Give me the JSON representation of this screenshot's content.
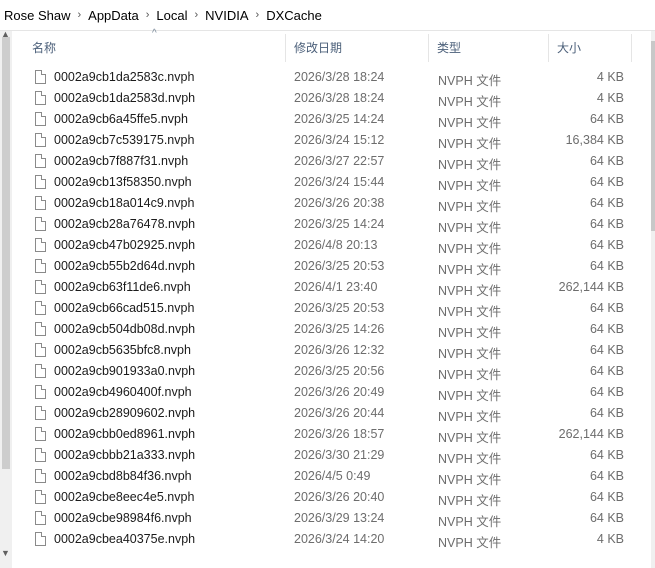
{
  "breadcrumb": [
    "Rose Shaw",
    "AppData",
    "Local",
    "NVIDIA",
    "DXCache"
  ],
  "columns": {
    "name": "名称",
    "date": "修改日期",
    "type": "类型",
    "size": "大小"
  },
  "files": [
    {
      "name": "0002a9cb1da2583c.nvph",
      "date": "2026/3/28 18:24",
      "type": "NVPH 文件",
      "size": "4 KB"
    },
    {
      "name": "0002a9cb1da2583d.nvph",
      "date": "2026/3/28 18:24",
      "type": "NVPH 文件",
      "size": "4 KB"
    },
    {
      "name": "0002a9cb6a45ffe5.nvph",
      "date": "2026/3/25 14:24",
      "type": "NVPH 文件",
      "size": "64 KB"
    },
    {
      "name": "0002a9cb7c539175.nvph",
      "date": "2026/3/24 15:12",
      "type": "NVPH 文件",
      "size": "16,384 KB"
    },
    {
      "name": "0002a9cb7f887f31.nvph",
      "date": "2026/3/27 22:57",
      "type": "NVPH 文件",
      "size": "64 KB"
    },
    {
      "name": "0002a9cb13f58350.nvph",
      "date": "2026/3/24 15:44",
      "type": "NVPH 文件",
      "size": "64 KB"
    },
    {
      "name": "0002a9cb18a014c9.nvph",
      "date": "2026/3/26 20:38",
      "type": "NVPH 文件",
      "size": "64 KB"
    },
    {
      "name": "0002a9cb28a76478.nvph",
      "date": "2026/3/25 14:24",
      "type": "NVPH 文件",
      "size": "64 KB"
    },
    {
      "name": "0002a9cb47b02925.nvph",
      "date": "2026/4/8 20:13",
      "type": "NVPH 文件",
      "size": "64 KB"
    },
    {
      "name": "0002a9cb55b2d64d.nvph",
      "date": "2026/3/25 20:53",
      "type": "NVPH 文件",
      "size": "64 KB"
    },
    {
      "name": "0002a9cb63f11de6.nvph",
      "date": "2026/4/1 23:40",
      "type": "NVPH 文件",
      "size": "262,144 KB"
    },
    {
      "name": "0002a9cb66cad515.nvph",
      "date": "2026/3/25 20:53",
      "type": "NVPH 文件",
      "size": "64 KB"
    },
    {
      "name": "0002a9cb504db08d.nvph",
      "date": "2026/3/25 14:26",
      "type": "NVPH 文件",
      "size": "64 KB"
    },
    {
      "name": "0002a9cb5635bfc8.nvph",
      "date": "2026/3/26 12:32",
      "type": "NVPH 文件",
      "size": "64 KB"
    },
    {
      "name": "0002a9cb901933a0.nvph",
      "date": "2026/3/25 20:56",
      "type": "NVPH 文件",
      "size": "64 KB"
    },
    {
      "name": "0002a9cb4960400f.nvph",
      "date": "2026/3/26 20:49",
      "type": "NVPH 文件",
      "size": "64 KB"
    },
    {
      "name": "0002a9cb28909602.nvph",
      "date": "2026/3/26 20:44",
      "type": "NVPH 文件",
      "size": "64 KB"
    },
    {
      "name": "0002a9cbb0ed8961.nvph",
      "date": "2026/3/26 18:57",
      "type": "NVPH 文件",
      "size": "262,144 KB"
    },
    {
      "name": "0002a9cbbb21a333.nvph",
      "date": "2026/3/30 21:29",
      "type": "NVPH 文件",
      "size": "64 KB"
    },
    {
      "name": "0002a9cbd8b84f36.nvph",
      "date": "2026/4/5 0:49",
      "type": "NVPH 文件",
      "size": "64 KB"
    },
    {
      "name": "0002a9cbe8eec4e5.nvph",
      "date": "2026/3/26 20:40",
      "type": "NVPH 文件",
      "size": "64 KB"
    },
    {
      "name": "0002a9cbe98984f6.nvph",
      "date": "2026/3/29 13:24",
      "type": "NVPH 文件",
      "size": "64 KB"
    },
    {
      "name": "0002a9cbea40375e.nvph",
      "date": "2026/3/24 14:20",
      "type": "NVPH 文件",
      "size": "4 KB"
    }
  ]
}
